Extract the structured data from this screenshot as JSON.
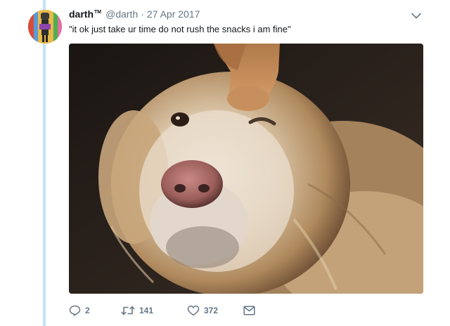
{
  "user": {
    "display_name": "darth",
    "trademark": "TM",
    "handle": "@darth",
    "separator": "·",
    "date": "27 Apr 2017"
  },
  "tweet": {
    "text": "\"it ok just take ur time do not rush the snacks i am fine\""
  },
  "actions": {
    "reply_count": "2",
    "retweet_count": "141",
    "like_count": "372"
  },
  "icons": {
    "more": "chevron-down-icon",
    "reply": "reply-icon",
    "retweet": "retweet-icon",
    "like": "heart-icon",
    "dm": "envelope-icon"
  },
  "colors": {
    "thread_line": "#c4e2f5",
    "secondary_text": "#657786",
    "primary_text": "#14171a"
  }
}
